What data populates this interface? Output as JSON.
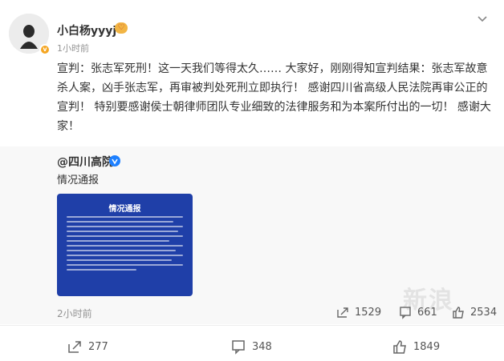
{
  "post": {
    "username": "小白杨yyyj",
    "user_badge": "♡",
    "time": "1小时前",
    "text": "宣判：张志军死刑！这一天我们等得太久…… 大家好，刚刚得知宣判结果：张志军故意杀人案，凶手张志军，再审被判处死刑立即执行！ 感谢四川省高级人民法院再审公正的宣判！ 特别要感谢侯士朝律师团队专业细致的法律服务和为本案所付出的一切！ 感谢大家！",
    "verified_icon": "v-badge-icon",
    "more_icon": "chevron-down-icon"
  },
  "repost": {
    "author": "@四川高院",
    "author_verified_icon": "blue-v-icon",
    "text": "情况通报",
    "image": {
      "title": "情况通报",
      "description_icon": "notice-image"
    },
    "time": "2小时前",
    "stats": {
      "reposts": "1529",
      "comments": "661",
      "likes": "2534"
    }
  },
  "footer": {
    "reposts": "277",
    "comments": "348",
    "likes": "1849"
  },
  "colors": {
    "accent_blue": "#1e80ff",
    "notice_blue": "#1f3fa8",
    "badge_orange": "#f5a623"
  }
}
